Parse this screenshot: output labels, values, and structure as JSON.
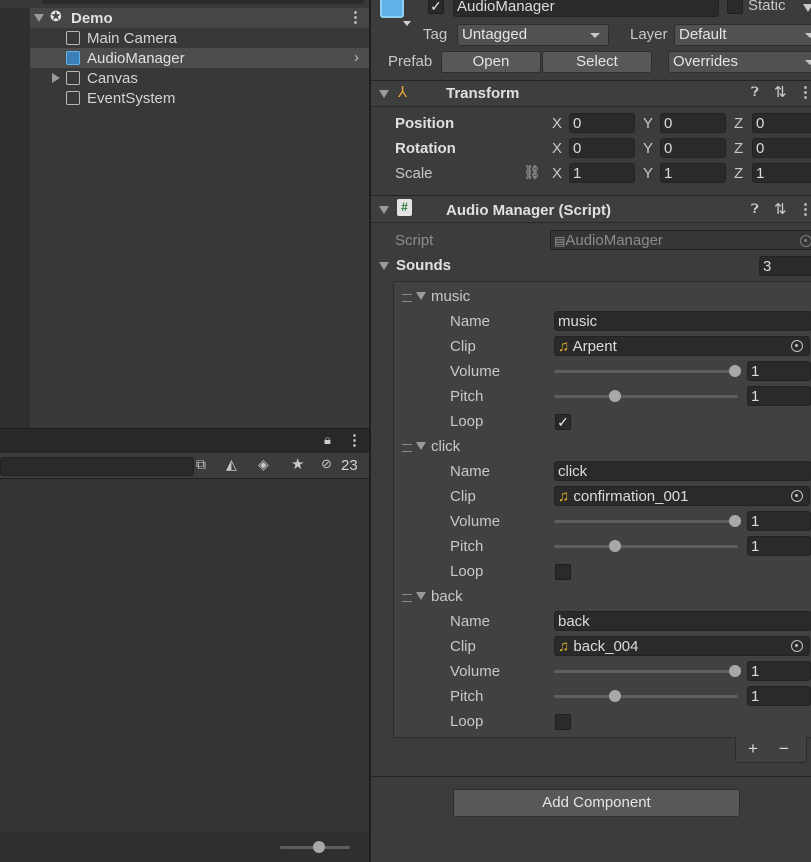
{
  "hierarchy": {
    "scene": "Demo",
    "items": [
      "Main Camera",
      "AudioManager",
      "Canvas",
      "EventSystem"
    ]
  },
  "project": {
    "hidden_count": "23"
  },
  "inspector": {
    "object_name": "AudioManager",
    "static_label": "Static",
    "tag_label": "Tag",
    "tag_value": "Untagged",
    "layer_label": "Layer",
    "layer_value": "Default",
    "prefab_label": "Prefab",
    "open_label": "Open",
    "select_label": "Select",
    "overrides_label": "Overrides",
    "transform": {
      "title": "Transform",
      "position_label": "Position",
      "rotation_label": "Rotation",
      "scale_label": "Scale",
      "x": "X",
      "y": "Y",
      "z": "Z",
      "position": [
        "0",
        "0",
        "0"
      ],
      "rotation": [
        "0",
        "0",
        "0"
      ],
      "scale": [
        "1",
        "1",
        "1"
      ]
    },
    "audio_manager": {
      "title": "Audio Manager (Script)",
      "script_label": "Script",
      "script_value": "AudioManager",
      "sounds_label": "Sounds",
      "sounds_count": "3",
      "labels": {
        "name": "Name",
        "clip": "Clip",
        "volume": "Volume",
        "pitch": "Pitch",
        "loop": "Loop"
      },
      "sounds": [
        {
          "title": "music",
          "name": "music",
          "clip": "Arpent",
          "volume": "1",
          "pitch": "1",
          "loop": true
        },
        {
          "title": "click",
          "name": "click",
          "clip": "confirmation_001",
          "volume": "1",
          "pitch": "1",
          "loop": false
        },
        {
          "title": "back",
          "name": "back",
          "clip": "back_004",
          "volume": "1",
          "pitch": "1",
          "loop": false
        }
      ],
      "plus": "+",
      "minus": "−"
    },
    "add_component": "Add Component"
  },
  "colors": {
    "selected_row": "#4d4d4d",
    "icon_blue": "#5fb3e6",
    "clip_icon": "#e6b422"
  }
}
